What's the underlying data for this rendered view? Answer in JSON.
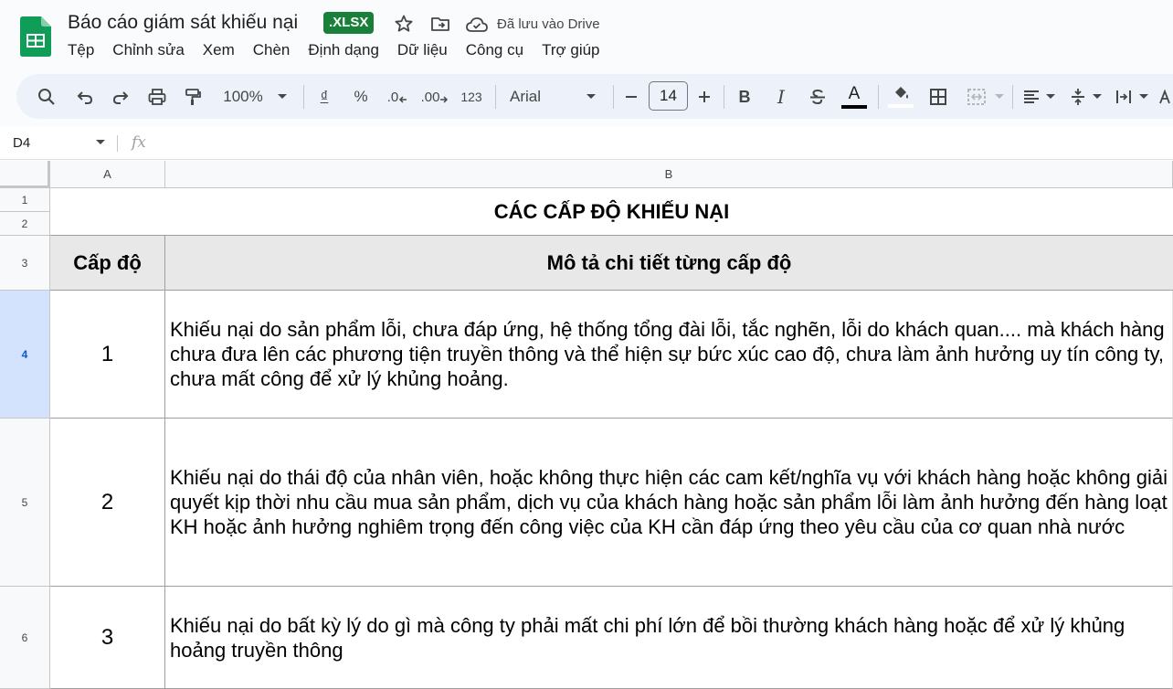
{
  "app": {
    "doc_title": "Báo cáo giám sát khiếu nại",
    "file_badge": ".XLSX",
    "saved_status": "Đã lưu vào Drive",
    "menu": [
      "Tệp",
      "Chỉnh sửa",
      "Xem",
      "Chèn",
      "Định dạng",
      "Dữ liệu",
      "Công cụ",
      "Trợ giúp"
    ],
    "brand_color": "#188038"
  },
  "toolbar": {
    "zoom": "100%",
    "currency": "₫",
    "percent": "%",
    "decrease_decimal": ".0",
    "increase_decimal": ".00",
    "number_format": "123",
    "font_family": "Arial",
    "font_size": "14",
    "bold": "B",
    "italic": "I",
    "text_color": "A",
    "text_color_bar": "#000000"
  },
  "formula_bar": {
    "name_box": "D4",
    "fx": "fx",
    "value": ""
  },
  "sheet": {
    "columns": [
      "A",
      "B"
    ],
    "rows": [
      "1",
      "2",
      "3",
      "4",
      "5",
      "6"
    ],
    "selected_row": "4",
    "title": "CÁC CẤP ĐỘ KHIẾU NẠI",
    "header": {
      "level": "Cấp độ",
      "description": "Mô tả chi tiết từng cấp độ"
    },
    "header_bg": "#e8e8e8",
    "levels": [
      {
        "level": "1",
        "description": "Khiếu nại do sản phẩm lỗi, chưa đáp ứng, hệ thống tổng đài lỗi, tắc nghẽn, lỗi do khách quan.... mà khách hàng chưa đưa lên các phương tiện truyền thông và thể hiện sự bức xúc cao độ, chưa làm ảnh hưởng uy tín công ty, chưa mất công để xử lý khủng hoảng."
      },
      {
        "level": "2",
        "description": "Khiếu nại do thái độ của nhân viên, hoặc không thực hiện các cam kết/nghĩa vụ với khách hàng hoặc không giải quyết kịp thời nhu cầu mua sản phẩm, dịch vụ của khách hàng hoặc sản phẩm lỗi làm ảnh hưởng đến hàng loạt KH hoặc ảnh hưởng nghiêm trọng đến công việc của KH cần đáp ứng theo yêu cầu của cơ quan nhà nước"
      },
      {
        "level": "3",
        "description": "Khiếu nại do bất kỳ lý do gì mà công ty phải mất chi phí lớn để bồi thường khách hàng hoặc để xử lý khủng hoảng truyền thông"
      }
    ]
  }
}
